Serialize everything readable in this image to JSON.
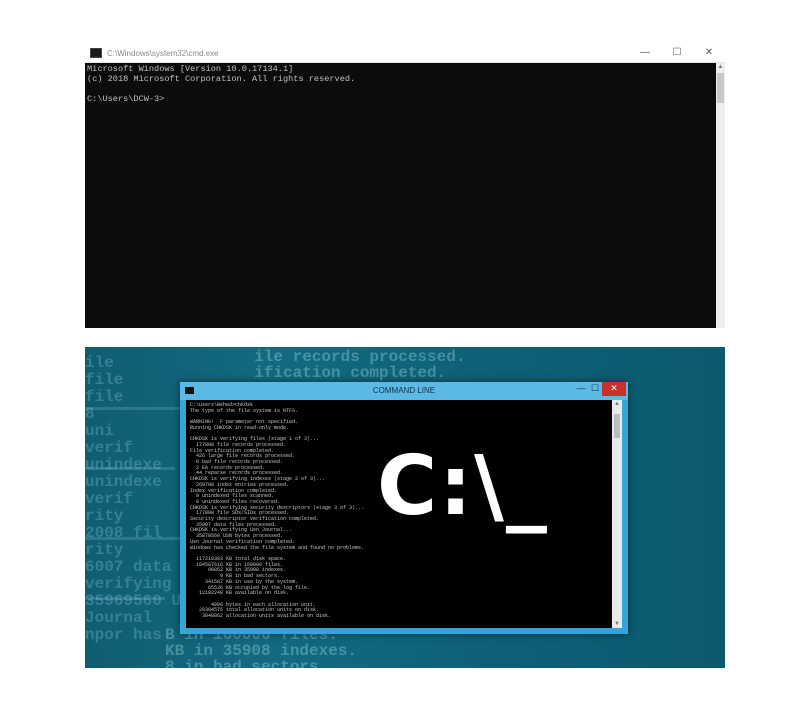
{
  "top_window": {
    "title": "C:\\Windows\\system32\\cmd.exe",
    "controls": {
      "minimize": "—",
      "maximize": "☐",
      "close": "✕"
    },
    "console_lines": [
      "Microsoft Windows [Version 10.0.17134.1]",
      "(c) 2018 Microsoft Corporation. All rights reserved.",
      "",
      "C:\\Users\\DCW-3>"
    ]
  },
  "bottom_image": {
    "background_text": {
      "top": "  ile records processed.\n  ification completed.",
      "left": "ile\nfile\nfile\n8\nuni\nverif\nunindexe\nunindexe\nverif\nrity\n2008 fil\nrity\n6007 data\nverifying\n35969560 U\nJournal\nnpor has",
      "bottom": "B in 160006 files.\nKB in 35908 indexes.\n8 in bad sectors."
    },
    "window": {
      "title": "COMMAND LINE",
      "controls": {
        "minimize": "—",
        "maximize": "☐",
        "close": "✕"
      },
      "console_text": "C:\\Users\\Behed>chkdsk\nThe type of the file system is NTFS.\n\nWARNING!  F parameter not specified.\nRunning CHKDSK in read-only mode.\n\nCHKDSK is verifying files (stage 1 of 3)...\n  177808 file records processed.\nFile verification completed.\n  426 large file records processed.\n  0 bad file records processed.\n  2 EA records processed.\n  44 reparse records processed.\nCHKDSK is verifying indexes (stage 2 of 3)...\n  269708 index entries processed.\nIndex verification completed.\n  0 unindexed files scanned.\n  0 unindexed files recovered.\nCHKDSK is verifying security descriptors (stage 3 of 3)...\n  177808 file SDs/SIDs processed.\nSecurity descriptor verification completed.\n  35907 data files processed.\nCHKDSK is verifying Usn Journal...\n  35879560 USN bytes processed.\nUsn Journal verification completed.\nWindows has checked the file system and found no problems.\n\n  117218303 KB total disk space.\n  104587616 KB in 160006 files.\n      96852 KB in 35908 indexes.\n          0 KB in bad sectors.\n     341587 KB in use by the system.\n      65536 KB occupied by the log file.\n   12192248 KB available on disk.\n\n       4096 bytes in each allocation unit.\n   29304575 total allocation units on disk.\n    3048062 allocation units available on disk.",
      "overlay_text": "C:\\_"
    }
  }
}
